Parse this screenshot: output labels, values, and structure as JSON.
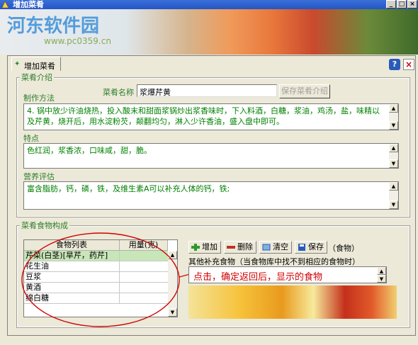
{
  "window": {
    "title": "增加菜肴",
    "min": "_",
    "max": "□",
    "close": "×"
  },
  "watermark": {
    "brand": "河东软件园",
    "url": "www.pc0359.cn"
  },
  "tab": {
    "label": "增加菜肴"
  },
  "header_buttons": {
    "help": "?",
    "close": "×"
  },
  "intro": {
    "legend": "菜肴介绍",
    "dish_name_label": "菜肴名称",
    "dish_name_value": "浆爆芹黄",
    "save_intro_button": "保存菜肴介绍",
    "method_label": "制作方法",
    "method_text": "4. 锅中放少许油烧热，投入酸末和甜面浆锅炒出浆香味时，下入料酒，白糖，浆油，鸡汤，盐，味精以及芹黄，烧开后，用水淀粉芡，颠翻均匀，淋入少许香油，盛入盘中即可。",
    "features_label": "特点",
    "features_text": "色红润，浆香浓，口味咸，甜，脆。",
    "nutrition_label": "营养评估",
    "nutrition_text": "富含脂肪，钙，磷，铁，及维生素A可以补充人体的钙，铁;"
  },
  "composition": {
    "legend": "菜肴食物构成",
    "grid_headers": [
      "食物列表",
      "用量(克)"
    ],
    "rows": [
      {
        "name": "芹菜(白茎)[旱芹，药芹]",
        "qty": ""
      },
      {
        "name": "花生油",
        "qty": ""
      },
      {
        "name": "豆浆",
        "qty": ""
      },
      {
        "name": "黄酒",
        "qty": ""
      },
      {
        "name": "绵白糖",
        "qty": ""
      }
    ],
    "buttons": {
      "add": "增加",
      "delete": "删除",
      "clear": "清空",
      "save": "保存",
      "save_suffix": "（食物）"
    },
    "other_label": "其他补充食物（当食物库中找不到相应的食物时）",
    "annotation": "点击，确定返回后，显示的食物"
  },
  "colors": {
    "accent_green": "#2e7d2e",
    "text_green": "#008000",
    "selected_row": "#c8e6b8",
    "annotation_red": "#d00000"
  }
}
